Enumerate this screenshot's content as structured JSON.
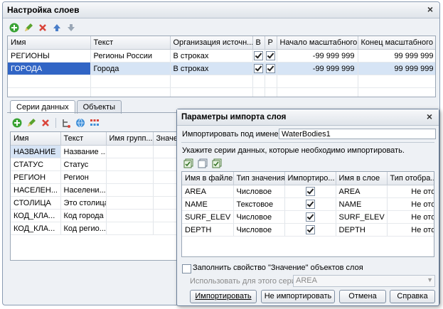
{
  "main_window": {
    "title": "Настройка слоев",
    "close_symbol": "×",
    "layers_table": {
      "columns": [
        "Имя",
        "Текст",
        "Организация источн...",
        "В",
        "Р",
        "Начало масштабного...",
        "Конец масштабного ..."
      ],
      "rows": [
        {
          "name": "РЕГИОНЫ",
          "text": "Регионы России",
          "org": "В строках",
          "v": true,
          "r": true,
          "start": "-99 999 999",
          "end": "99 999 999"
        },
        {
          "name": "ГОРОДА",
          "text": "Города",
          "org": "В строках",
          "v": true,
          "r": true,
          "start": "-99 999 999",
          "end": "99 999 999"
        }
      ]
    },
    "tabs": [
      "Серии данных",
      "Объекты"
    ],
    "series_table": {
      "columns": [
        "Имя",
        "Текст",
        "Имя групп...",
        "Значе"
      ],
      "rows": [
        {
          "name": "НАЗВАНИЕ",
          "text": "Название ..."
        },
        {
          "name": "СТАТУС",
          "text": "Статус"
        },
        {
          "name": "РЕГИОН",
          "text": "Регион"
        },
        {
          "name": "НАСЕЛЕН...",
          "text": "Населени..."
        },
        {
          "name": "СТОЛИЦА",
          "text": "Это столица"
        },
        {
          "name": "КОД_КЛА...",
          "text": "Код города"
        },
        {
          "name": "КОД_КЛА...",
          "text": "Код регио..."
        }
      ]
    }
  },
  "dialog": {
    "title": "Параметры импорта слоя",
    "close_symbol": "×",
    "import_as_label": "Импортировать под именем:",
    "import_as_value": "WaterBodies1",
    "instruction": "Укажите серии данных, которые необходимо импортировать.",
    "table": {
      "columns": [
        "Имя в файле",
        "Тип значения",
        "Импортиро...",
        "Имя в слое",
        "Тип отобра..."
      ],
      "rows": [
        {
          "file": "AREA",
          "type": "Числовое",
          "import": true,
          "layer": "AREA",
          "disp": "Не ото..."
        },
        {
          "file": "NAME",
          "type": "Текстовое",
          "import": true,
          "layer": "NAME",
          "disp": "Не ото..."
        },
        {
          "file": "SURF_ELEV",
          "type": "Числовое",
          "import": true,
          "layer": "SURF_ELEV",
          "disp": "Не ото..."
        },
        {
          "file": "DEPTH",
          "type": "Числовое",
          "import": true,
          "layer": "DEPTH",
          "disp": "Не ото..."
        }
      ]
    },
    "fill_checkbox_label": "Заполнить свойство \"Значение\" объектов слоя",
    "use_series_label": "Использовать для этого серию:",
    "use_series_value": "AREA",
    "buttons": {
      "import": "Импортировать",
      "no_import": "Не импортировать",
      "cancel": "Отмена",
      "help": "Справка"
    }
  },
  "colors": {
    "accent": "#3165c5",
    "selected_row": "#d6e4f5",
    "add_icon": "#3aa335",
    "delete_icon": "#d9443a"
  }
}
